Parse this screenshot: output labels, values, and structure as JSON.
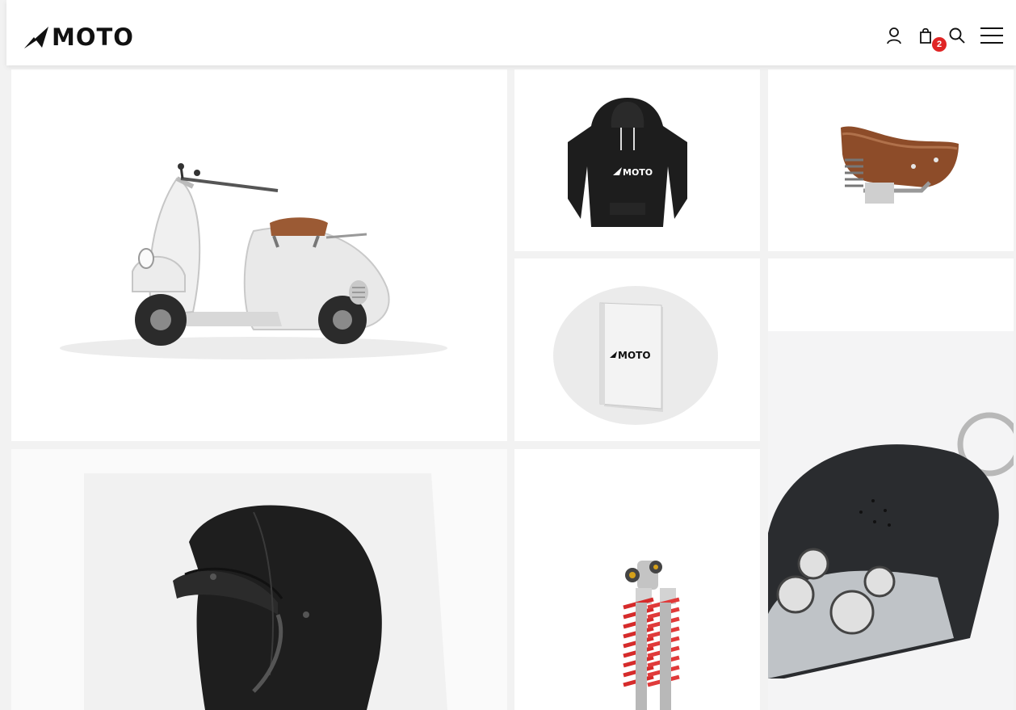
{
  "brand": {
    "name": "MOTO"
  },
  "header": {
    "cart_count": "2",
    "icons": [
      "user-icon",
      "shopping-bag-icon",
      "search-icon",
      "menu-icon"
    ]
  },
  "tiles": [
    {
      "name": "scooter",
      "product_mark": ""
    },
    {
      "name": "hoodie",
      "product_mark": "MOTO"
    },
    {
      "name": "seat",
      "product_mark": ""
    },
    {
      "name": "notebook",
      "product_mark": "MOTO"
    },
    {
      "name": "key-remote",
      "product_mark": ""
    },
    {
      "name": "helmet",
      "product_mark": ""
    },
    {
      "name": "shock-absorbers",
      "product_mark": ""
    }
  ],
  "colors": {
    "accent": "#e02424",
    "ink": "#111111",
    "background": "#f2f2f2"
  }
}
